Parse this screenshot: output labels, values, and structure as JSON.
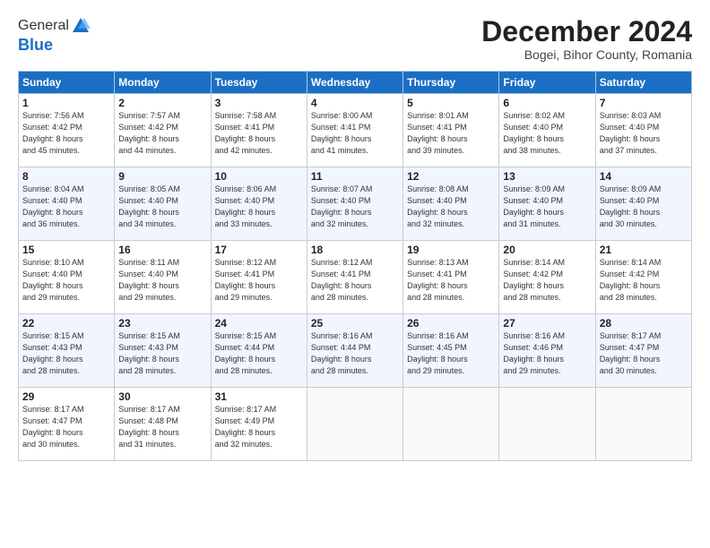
{
  "header": {
    "logo_line1": "General",
    "logo_line2": "Blue",
    "month_title": "December 2024",
    "subtitle": "Bogei, Bihor County, Romania"
  },
  "days_of_week": [
    "Sunday",
    "Monday",
    "Tuesday",
    "Wednesday",
    "Thursday",
    "Friday",
    "Saturday"
  ],
  "weeks": [
    [
      {
        "day": "1",
        "info": "Sunrise: 7:56 AM\nSunset: 4:42 PM\nDaylight: 8 hours\nand 45 minutes."
      },
      {
        "day": "2",
        "info": "Sunrise: 7:57 AM\nSunset: 4:42 PM\nDaylight: 8 hours\nand 44 minutes."
      },
      {
        "day": "3",
        "info": "Sunrise: 7:58 AM\nSunset: 4:41 PM\nDaylight: 8 hours\nand 42 minutes."
      },
      {
        "day": "4",
        "info": "Sunrise: 8:00 AM\nSunset: 4:41 PM\nDaylight: 8 hours\nand 41 minutes."
      },
      {
        "day": "5",
        "info": "Sunrise: 8:01 AM\nSunset: 4:41 PM\nDaylight: 8 hours\nand 39 minutes."
      },
      {
        "day": "6",
        "info": "Sunrise: 8:02 AM\nSunset: 4:40 PM\nDaylight: 8 hours\nand 38 minutes."
      },
      {
        "day": "7",
        "info": "Sunrise: 8:03 AM\nSunset: 4:40 PM\nDaylight: 8 hours\nand 37 minutes."
      }
    ],
    [
      {
        "day": "8",
        "info": "Sunrise: 8:04 AM\nSunset: 4:40 PM\nDaylight: 8 hours\nand 36 minutes."
      },
      {
        "day": "9",
        "info": "Sunrise: 8:05 AM\nSunset: 4:40 PM\nDaylight: 8 hours\nand 34 minutes."
      },
      {
        "day": "10",
        "info": "Sunrise: 8:06 AM\nSunset: 4:40 PM\nDaylight: 8 hours\nand 33 minutes."
      },
      {
        "day": "11",
        "info": "Sunrise: 8:07 AM\nSunset: 4:40 PM\nDaylight: 8 hours\nand 32 minutes."
      },
      {
        "day": "12",
        "info": "Sunrise: 8:08 AM\nSunset: 4:40 PM\nDaylight: 8 hours\nand 32 minutes."
      },
      {
        "day": "13",
        "info": "Sunrise: 8:09 AM\nSunset: 4:40 PM\nDaylight: 8 hours\nand 31 minutes."
      },
      {
        "day": "14",
        "info": "Sunrise: 8:09 AM\nSunset: 4:40 PM\nDaylight: 8 hours\nand 30 minutes."
      }
    ],
    [
      {
        "day": "15",
        "info": "Sunrise: 8:10 AM\nSunset: 4:40 PM\nDaylight: 8 hours\nand 29 minutes."
      },
      {
        "day": "16",
        "info": "Sunrise: 8:11 AM\nSunset: 4:40 PM\nDaylight: 8 hours\nand 29 minutes."
      },
      {
        "day": "17",
        "info": "Sunrise: 8:12 AM\nSunset: 4:41 PM\nDaylight: 8 hours\nand 29 minutes."
      },
      {
        "day": "18",
        "info": "Sunrise: 8:12 AM\nSunset: 4:41 PM\nDaylight: 8 hours\nand 28 minutes."
      },
      {
        "day": "19",
        "info": "Sunrise: 8:13 AM\nSunset: 4:41 PM\nDaylight: 8 hours\nand 28 minutes."
      },
      {
        "day": "20",
        "info": "Sunrise: 8:14 AM\nSunset: 4:42 PM\nDaylight: 8 hours\nand 28 minutes."
      },
      {
        "day": "21",
        "info": "Sunrise: 8:14 AM\nSunset: 4:42 PM\nDaylight: 8 hours\nand 28 minutes."
      }
    ],
    [
      {
        "day": "22",
        "info": "Sunrise: 8:15 AM\nSunset: 4:43 PM\nDaylight: 8 hours\nand 28 minutes."
      },
      {
        "day": "23",
        "info": "Sunrise: 8:15 AM\nSunset: 4:43 PM\nDaylight: 8 hours\nand 28 minutes."
      },
      {
        "day": "24",
        "info": "Sunrise: 8:15 AM\nSunset: 4:44 PM\nDaylight: 8 hours\nand 28 minutes."
      },
      {
        "day": "25",
        "info": "Sunrise: 8:16 AM\nSunset: 4:44 PM\nDaylight: 8 hours\nand 28 minutes."
      },
      {
        "day": "26",
        "info": "Sunrise: 8:16 AM\nSunset: 4:45 PM\nDaylight: 8 hours\nand 29 minutes."
      },
      {
        "day": "27",
        "info": "Sunrise: 8:16 AM\nSunset: 4:46 PM\nDaylight: 8 hours\nand 29 minutes."
      },
      {
        "day": "28",
        "info": "Sunrise: 8:17 AM\nSunset: 4:47 PM\nDaylight: 8 hours\nand 30 minutes."
      }
    ],
    [
      {
        "day": "29",
        "info": "Sunrise: 8:17 AM\nSunset: 4:47 PM\nDaylight: 8 hours\nand 30 minutes."
      },
      {
        "day": "30",
        "info": "Sunrise: 8:17 AM\nSunset: 4:48 PM\nDaylight: 8 hours\nand 31 minutes."
      },
      {
        "day": "31",
        "info": "Sunrise: 8:17 AM\nSunset: 4:49 PM\nDaylight: 8 hours\nand 32 minutes."
      },
      null,
      null,
      null,
      null
    ]
  ]
}
